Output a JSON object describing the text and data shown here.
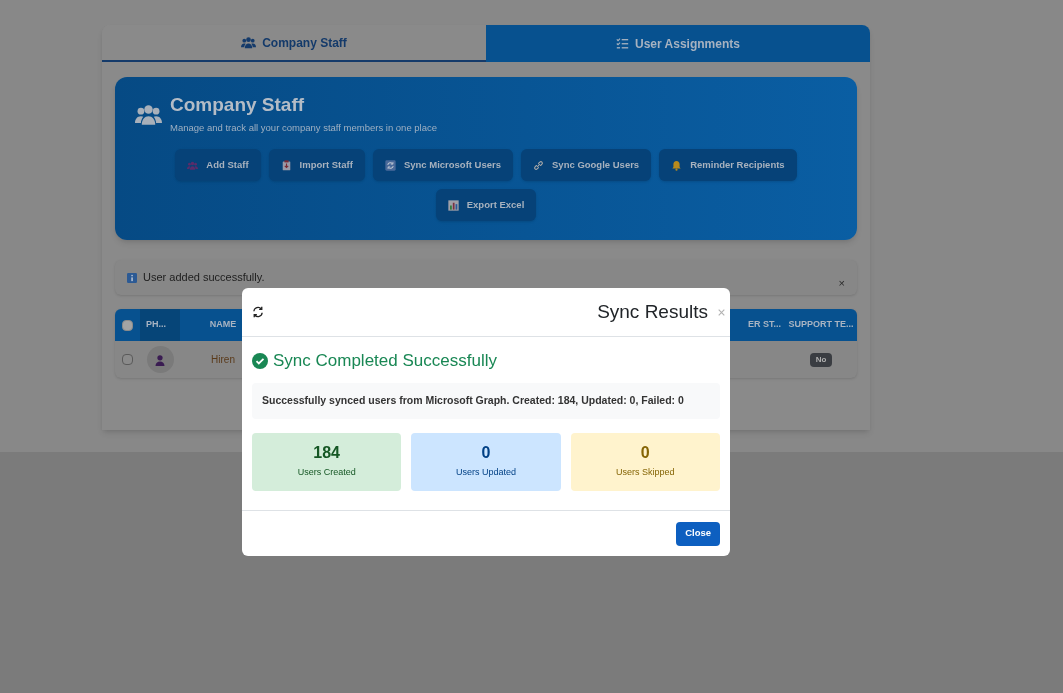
{
  "tabs": [
    {
      "label": "Company Staff",
      "kind": "users",
      "selected": true
    },
    {
      "label": "User Assignments",
      "kind": "checklist",
      "selected": false
    }
  ],
  "header": {
    "title": "Company Staff",
    "subtitle": "Manage and track all your company staff members in one place"
  },
  "actions": [
    {
      "label": "Add Staff",
      "kind": "people"
    },
    {
      "label": "Import Staff",
      "kind": "import"
    },
    {
      "label": "Sync Microsoft Users",
      "kind": "sync"
    },
    {
      "label": "Sync Google Users",
      "kind": "link"
    },
    {
      "label": "Reminder Recipients",
      "kind": "bell"
    },
    {
      "label": "Export Excel",
      "kind": "chart"
    }
  ],
  "alert": {
    "message": "User added successfully.",
    "close": "×"
  },
  "table": {
    "select_all_checked": false,
    "columns": [
      {
        "label": "PH..."
      },
      {
        "label": "NAME"
      },
      {
        "label": "ER ST..."
      },
      {
        "label": "SUPPORT TE..."
      }
    ],
    "rows": [
      {
        "checked": false,
        "name": "Hiren",
        "support_team": "No"
      }
    ]
  },
  "modal": {
    "title": "Sync Results",
    "status": "Sync Completed Successfully",
    "message": "Successfully synced users from Microsoft Graph. Created: 184, Updated: 0, Failed: 0",
    "stats": [
      {
        "value": "184",
        "label": "Users Created",
        "kind": "created"
      },
      {
        "value": "0",
        "label": "Users Updated",
        "kind": "updated"
      },
      {
        "value": "0",
        "label": "Users Skipped",
        "kind": "skipped"
      }
    ],
    "buttons": [
      "Close"
    ]
  }
}
